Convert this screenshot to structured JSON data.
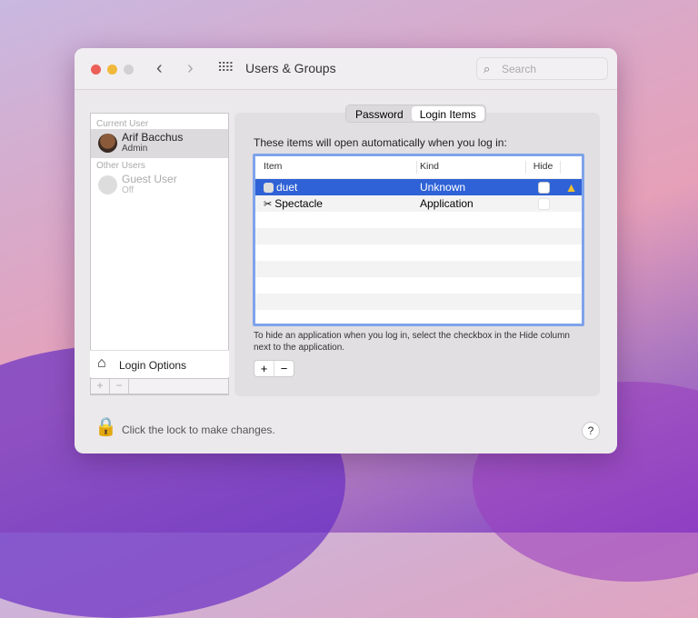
{
  "window": {
    "title": "Users & Groups",
    "search_placeholder": "Search"
  },
  "users": {
    "current_label": "Current User",
    "current": {
      "name": "Arif Bacchus",
      "role": "Admin"
    },
    "other_label": "Other Users",
    "other": {
      "name": "Guest User",
      "role": "Off"
    },
    "login_options": "Login Options",
    "add": "+",
    "remove": "−"
  },
  "tabs": [
    {
      "label": "Password"
    },
    {
      "label": "Login Items"
    }
  ],
  "login_items": {
    "description": "These items will open automatically when you log in:",
    "columns": [
      "Item",
      "Kind",
      "Hide"
    ],
    "rows": [
      {
        "item": "duet",
        "kind": "Unknown",
        "hidden": false,
        "warning": true,
        "selected": true
      },
      {
        "item": "Spectacle",
        "kind": "Application",
        "hidden": false,
        "warning": false,
        "selected": false
      }
    ],
    "hint": "To hide an application when you log in, select the checkbox in the Hide column next to the application.",
    "add": "+",
    "remove": "−"
  },
  "footer": {
    "lock_text": "Click the lock to make changes.",
    "help": "?"
  },
  "colors": {
    "selection": "#2f62d6",
    "focus_ring": "#7ea3ea"
  }
}
